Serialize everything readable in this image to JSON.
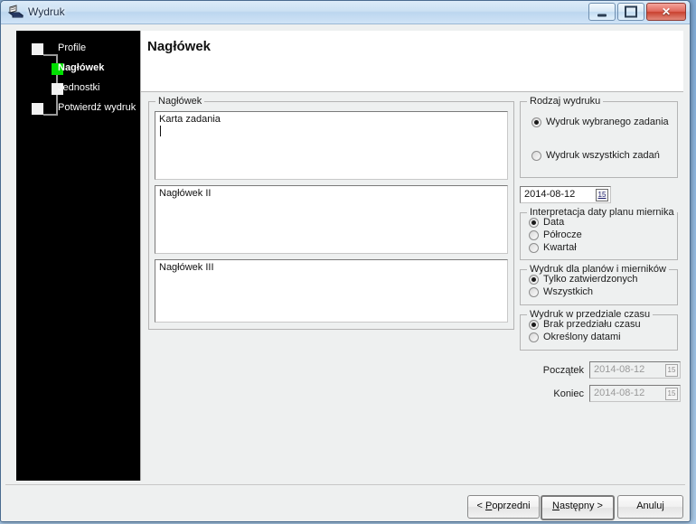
{
  "window": {
    "title": "Wydruk",
    "icon": "printer-icon",
    "controls": {
      "minimize": "minimize-icon",
      "maximize": "maximize-icon",
      "close": "close-icon"
    }
  },
  "sidebar": {
    "steps": [
      {
        "label": "Profile",
        "state": "done",
        "indent": 0
      },
      {
        "label": "Nagłówek",
        "state": "active",
        "indent": 1
      },
      {
        "label": "Jednostki",
        "state": "pending",
        "indent": 1
      },
      {
        "label": "Potwierdź wydruk",
        "state": "pending",
        "indent": 0
      }
    ],
    "active_color": "#00e000"
  },
  "pane": {
    "heading": "Nagłówek"
  },
  "header_group": {
    "legend": "Nagłówek",
    "fields": [
      {
        "name": "naglowek-1",
        "value": "Karta zadania",
        "caret": true
      },
      {
        "name": "naglowek-2",
        "value": "Nagłówek II",
        "caret": false
      },
      {
        "name": "naglowek-3",
        "value": "Nagłówek III",
        "caret": false
      }
    ]
  },
  "print_type": {
    "legend": "Rodzaj wydruku",
    "options": [
      {
        "label": "Wydruk wybranego zadania",
        "selected": true
      },
      {
        "label": "Wydruk wszystkich zadań",
        "selected": false
      }
    ]
  },
  "main_date": {
    "value": "2014-08-12",
    "button": "15"
  },
  "date_interpretation": {
    "legend": "Interpretacja daty planu miernika",
    "options": [
      {
        "label": "Data",
        "selected": true
      },
      {
        "label": "Półrocze",
        "selected": false
      },
      {
        "label": "Kwartał",
        "selected": false
      }
    ]
  },
  "plans_scope": {
    "legend": "Wydruk dla planów i mierników",
    "options": [
      {
        "label": "Tylko zatwierdzonych",
        "selected": true
      },
      {
        "label": "Wszystkich",
        "selected": false
      }
    ]
  },
  "time_range": {
    "legend": "Wydruk w przedziale czasu",
    "options": [
      {
        "label": "Brak przedziału czasu",
        "selected": true
      },
      {
        "label": "Określony datami",
        "selected": false
      }
    ],
    "start": {
      "label": "Początek",
      "value": "2014-08-12",
      "button": "15",
      "disabled": true
    },
    "end": {
      "label": "Koniec",
      "value": "2014-08-12",
      "button": "15",
      "disabled": true
    }
  },
  "footer": {
    "prev": {
      "pre": "< ",
      "mn": "P",
      "post": "oprzedni"
    },
    "next": {
      "pre": "",
      "mn": "N",
      "post": "astępny >"
    },
    "cancel": {
      "label": "Anuluj"
    }
  }
}
